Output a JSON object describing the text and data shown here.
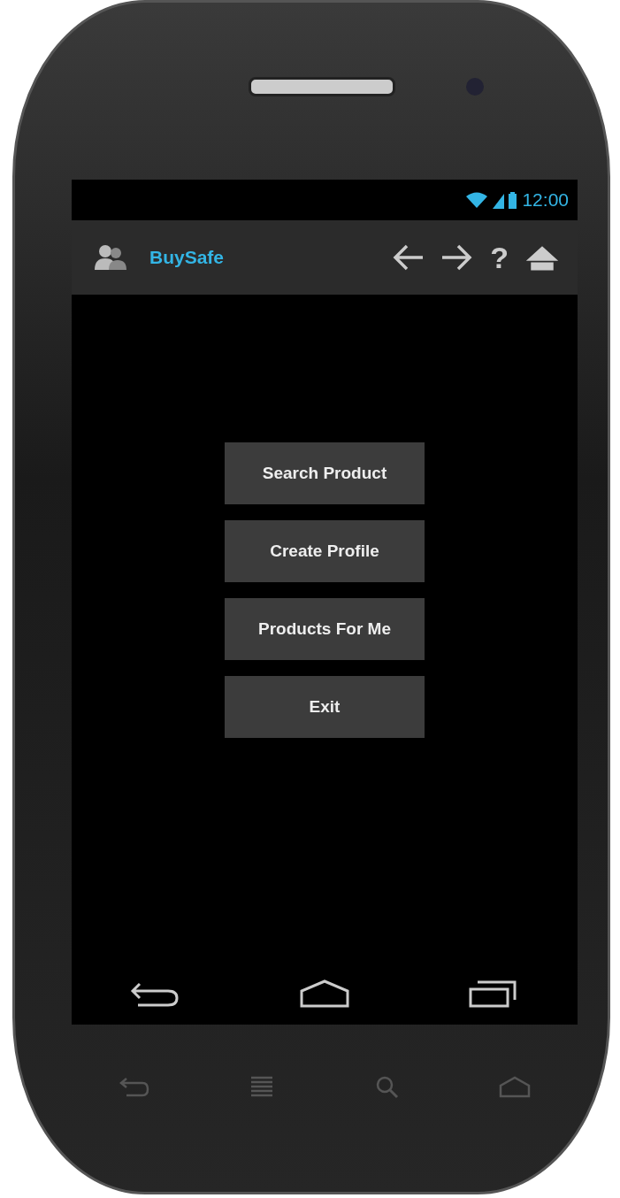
{
  "status_bar": {
    "time": "12:00"
  },
  "action_bar": {
    "title": "BuySafe",
    "actions": [
      {
        "kind": "back"
      },
      {
        "kind": "forward"
      },
      {
        "kind": "help",
        "label": "?"
      },
      {
        "kind": "home"
      }
    ]
  },
  "menu_buttons": [
    {
      "label": "Search Product"
    },
    {
      "label": "Create Profile"
    },
    {
      "label": "Products For Me"
    },
    {
      "label": "Exit"
    }
  ]
}
